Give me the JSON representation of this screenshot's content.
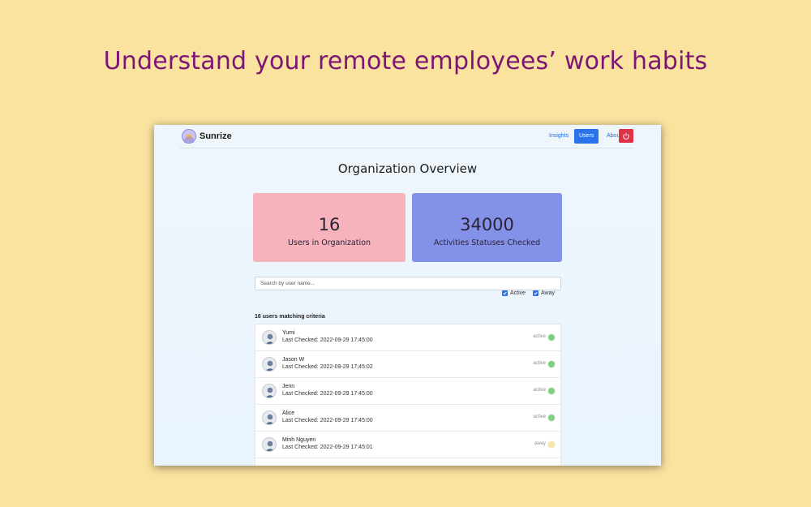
{
  "headline": "Understand your remote employees’ work habits",
  "nav": {
    "brand": "Sunrize",
    "links": [
      "Insights",
      "Users",
      "About"
    ],
    "active_link": "Users"
  },
  "page_title": "Organization Overview",
  "stats": [
    {
      "value": "16",
      "label": "Users in Organization"
    },
    {
      "value": "34000",
      "label": "Activities Statuses Checked"
    }
  ],
  "search": {
    "placeholder": "Search by user name...",
    "value": ""
  },
  "filters": [
    {
      "label": "Active",
      "checked": true
    },
    {
      "label": "Away",
      "checked": true
    }
  ],
  "match_count": "16 users matching criteria",
  "colors": {
    "active": "#7ed07f",
    "away": "#f7e7a0",
    "accent": "#2a73ea",
    "danger": "#de3246"
  },
  "users": [
    {
      "name": "Yumi",
      "last_checked": "Last Checked: 2022-09-29 17:45:00",
      "status": "active"
    },
    {
      "name": "Jason W",
      "last_checked": "Last Checked: 2022-09-29 17:45:02",
      "status": "active"
    },
    {
      "name": "Jenn",
      "last_checked": "Last Checked: 2022-09-29 17:45:00",
      "status": "active"
    },
    {
      "name": "Alice",
      "last_checked": "Last Checked: 2022-09-29 17:45:00",
      "status": "active"
    },
    {
      "name": "Minh Nguyen",
      "last_checked": "Last Checked: 2022-09-29 17:45:01",
      "status": "away"
    }
  ]
}
